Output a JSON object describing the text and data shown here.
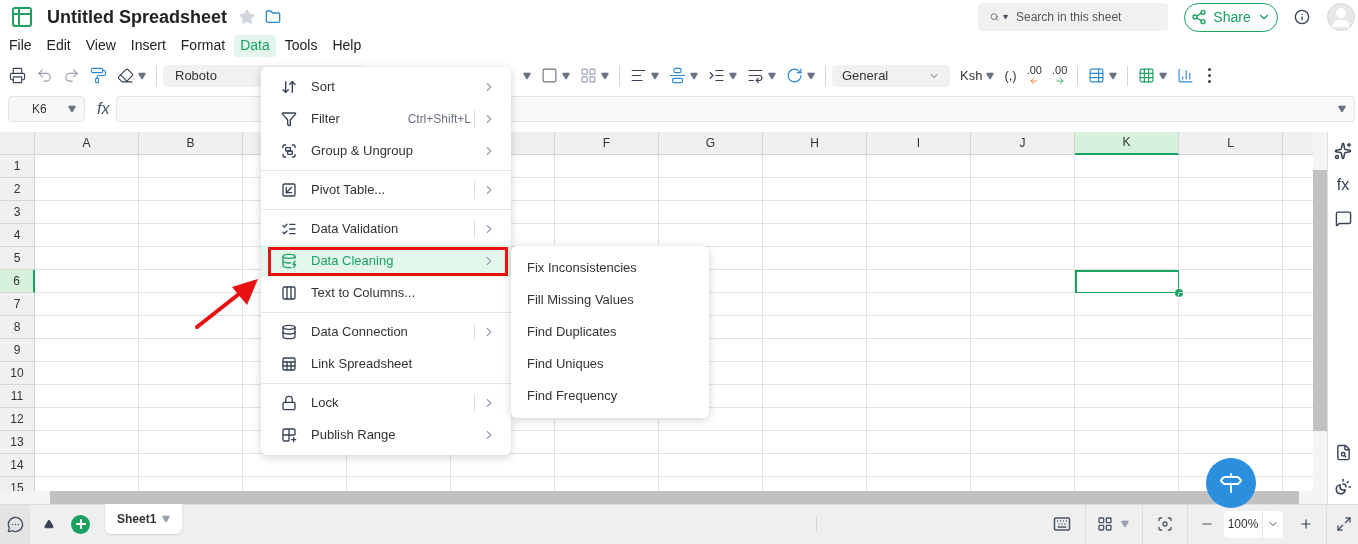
{
  "header": {
    "title": "Untitled Spreadsheet",
    "search": {
      "placeholder": "Search in this sheet"
    },
    "share_button": "Share"
  },
  "menu_bar": [
    {
      "label": "File",
      "selected": false
    },
    {
      "label": "Edit",
      "selected": false
    },
    {
      "label": "View",
      "selected": false
    },
    {
      "label": "Insert",
      "selected": false
    },
    {
      "label": "Format",
      "selected": false
    },
    {
      "label": "Data",
      "selected": true
    },
    {
      "label": "Tools",
      "selected": false
    },
    {
      "label": "Help",
      "selected": false
    }
  ],
  "toolbar": {
    "font": "Roboto",
    "number_format": "General",
    "currency": "Ksh",
    "comma_style": "(,)",
    "decrease_decimal": ".00",
    "increase_decimal": ".00"
  },
  "formula_bar": {
    "cell_reference": "K6",
    "fx": "fx"
  },
  "columns": [
    {
      "kind": "labeled",
      "label": "A",
      "selected": false
    },
    {
      "kind": "labeled",
      "label": "B",
      "selected": false
    },
    {
      "kind": "covered"
    },
    {
      "kind": "hidden"
    },
    {
      "kind": "covered"
    },
    {
      "kind": "labeled",
      "label": "F",
      "selected": false
    },
    {
      "kind": "labeled",
      "label": "G",
      "selected": false
    },
    {
      "kind": "labeled",
      "label": "H",
      "selected": false
    },
    {
      "kind": "labeled",
      "label": "I",
      "selected": false
    },
    {
      "kind": "labeled",
      "label": "J",
      "selected": false
    },
    {
      "kind": "labeled",
      "label": "K",
      "selected": true
    },
    {
      "kind": "labeled",
      "label": "L",
      "selected": false
    }
  ],
  "rows": [
    {
      "label": "1",
      "selected": false
    },
    {
      "label": "2",
      "selected": false
    },
    {
      "label": "3",
      "selected": false
    },
    {
      "label": "4",
      "selected": false
    },
    {
      "label": "5",
      "selected": false
    },
    {
      "label": "6",
      "selected": true
    },
    {
      "label": "7",
      "selected": false
    },
    {
      "label": "8",
      "selected": false
    },
    {
      "label": "9",
      "selected": false
    },
    {
      "label": "10",
      "selected": false
    },
    {
      "label": "11",
      "selected": false
    },
    {
      "label": "12",
      "selected": false
    },
    {
      "label": "13",
      "selected": false
    },
    {
      "label": "14",
      "selected": false
    },
    {
      "label": "15",
      "selected": false
    }
  ],
  "data_menu": {
    "groups": [
      [
        {
          "label": "Sort",
          "submenu": true,
          "split": false,
          "selected": false
        },
        {
          "label": "Filter",
          "shortcut": "Ctrl+Shift+L",
          "submenu": true,
          "split": true,
          "selected": false
        },
        {
          "label": "Group & Ungroup",
          "submenu": true,
          "split": false,
          "selected": false
        }
      ],
      [
        {
          "label": "Pivot Table...",
          "submenu": true,
          "split": true,
          "selected": false
        }
      ],
      [
        {
          "label": "Data Validation",
          "submenu": true,
          "split": true,
          "selected": false
        },
        {
          "label": "Data Cleaning",
          "submenu": true,
          "split": false,
          "selected": true
        },
        {
          "label": "Text to Columns...",
          "submenu": false,
          "split": false,
          "selected": false
        }
      ],
      [
        {
          "label": "Data Connection",
          "submenu": true,
          "split": true,
          "selected": false
        },
        {
          "label": "Link Spreadsheet",
          "submenu": false,
          "split": false,
          "selected": false
        }
      ],
      [
        {
          "label": "Lock",
          "submenu": true,
          "split": true,
          "selected": false
        },
        {
          "label": "Publish Range",
          "submenu": true,
          "split": false,
          "selected": false
        }
      ]
    ]
  },
  "submenu": [
    "Fix Inconsistencies",
    "Fill Missing Values",
    "Find Duplicates",
    "Find Uniques",
    "Find Frequency"
  ],
  "side_panel": {
    "function_label": "fx"
  },
  "sheet_tabs": [
    {
      "label": "Sheet1",
      "selected": true
    }
  ],
  "status_bar": {
    "zoom": "100%"
  }
}
